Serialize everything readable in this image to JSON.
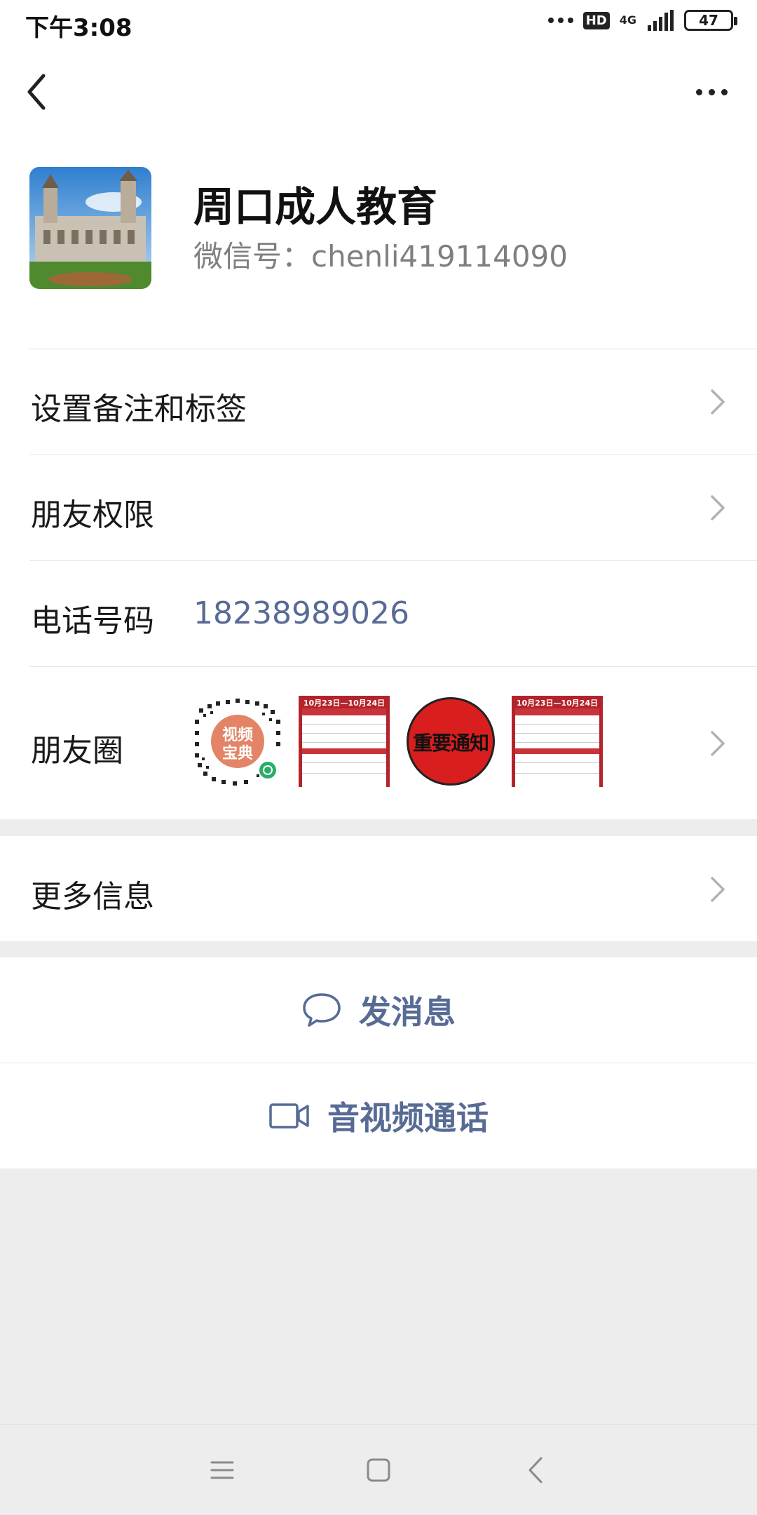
{
  "status_bar": {
    "time": "下午3:08",
    "hd": "HD",
    "network": "4G",
    "battery": "47"
  },
  "profile": {
    "name": "周口成人教育",
    "wechat_id": "微信号：chenli419114090"
  },
  "menu": {
    "remark_tags": "设置备注和标签",
    "friend_permissions": "朋友权限",
    "phone_label": "电话号码",
    "phone_value": "18238989026",
    "moments_label": "朋友圈",
    "more_info": "更多信息"
  },
  "moments_thumbs": {
    "qr_text_top": "视频",
    "qr_text_bottom": "宝典",
    "schedule_header": "10月23日—10月24日",
    "notice_text": "重要通知"
  },
  "actions": {
    "message": "发消息",
    "video_call": "音视频通话"
  },
  "colors": {
    "link": "#576b95",
    "background": "#ededed",
    "notice_red": "#d81e1e"
  }
}
